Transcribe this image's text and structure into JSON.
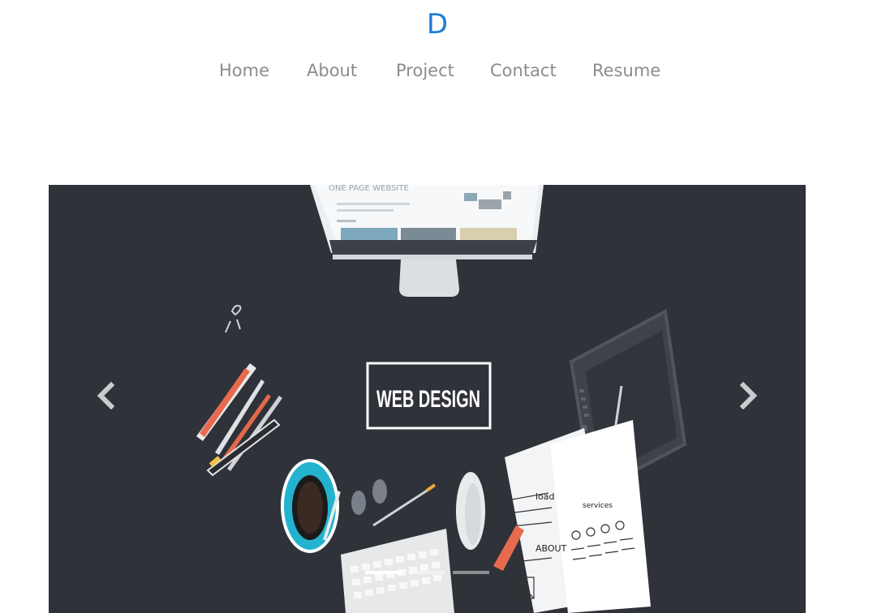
{
  "brand": {
    "letter": "D",
    "color": "#1a7fd6"
  },
  "nav": {
    "items": [
      {
        "label": "Home"
      },
      {
        "label": "About"
      },
      {
        "label": "Project"
      },
      {
        "label": "Contact"
      },
      {
        "label": "Resume"
      }
    ]
  },
  "carousel": {
    "background": "#2f3238",
    "headline": "WEB DESIGN",
    "monitor_text": "ONE PAGE WEBSITE",
    "sketch_text_about": "ABOUT",
    "sketch_text_load": "load",
    "sketch_text_services": "services",
    "prev_icon": "chevron-left-icon",
    "next_icon": "chevron-right-icon",
    "indicator_count": 3,
    "active_indicator": 1
  }
}
